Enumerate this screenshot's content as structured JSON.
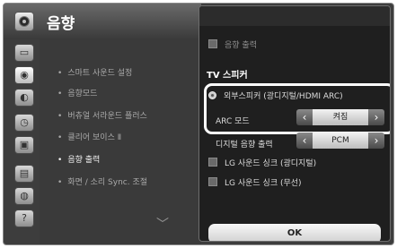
{
  "header": {
    "title": "음향"
  },
  "sidebar": {
    "icons": [
      "monitor-icon",
      "speaker-icon",
      "satellite-icon",
      "clock-icon",
      "lock-icon",
      "keyboard-icon",
      "globe-icon",
      "help-icon"
    ]
  },
  "menu": {
    "items": [
      {
        "label": "스마트 사운드 설정"
      },
      {
        "label": "음향모드"
      },
      {
        "label": "버츄얼 서라운드 플러스"
      },
      {
        "label": "클리어 보이스 Ⅱ"
      },
      {
        "label": "음향 출력"
      },
      {
        "label": "화면 / 소리 Sync. 조절"
      }
    ]
  },
  "panel": {
    "sound_output_label": "음향 출력",
    "tv_speaker_section": "TV 스피커",
    "external_speaker_label": "외부스피커 (광디지털/HDMI ARC)",
    "arc_mode_label": "ARC 모드",
    "arc_mode_value": "켜짐",
    "digital_output_label": "디지털 음향 출력",
    "digital_output_value": "PCM",
    "lg_sync_optical_label": "LG 사운드 싱크 (광디지털)",
    "lg_sync_wireless_label": "LG 사운드 싱크 (무선)",
    "ok_label": "OK"
  }
}
